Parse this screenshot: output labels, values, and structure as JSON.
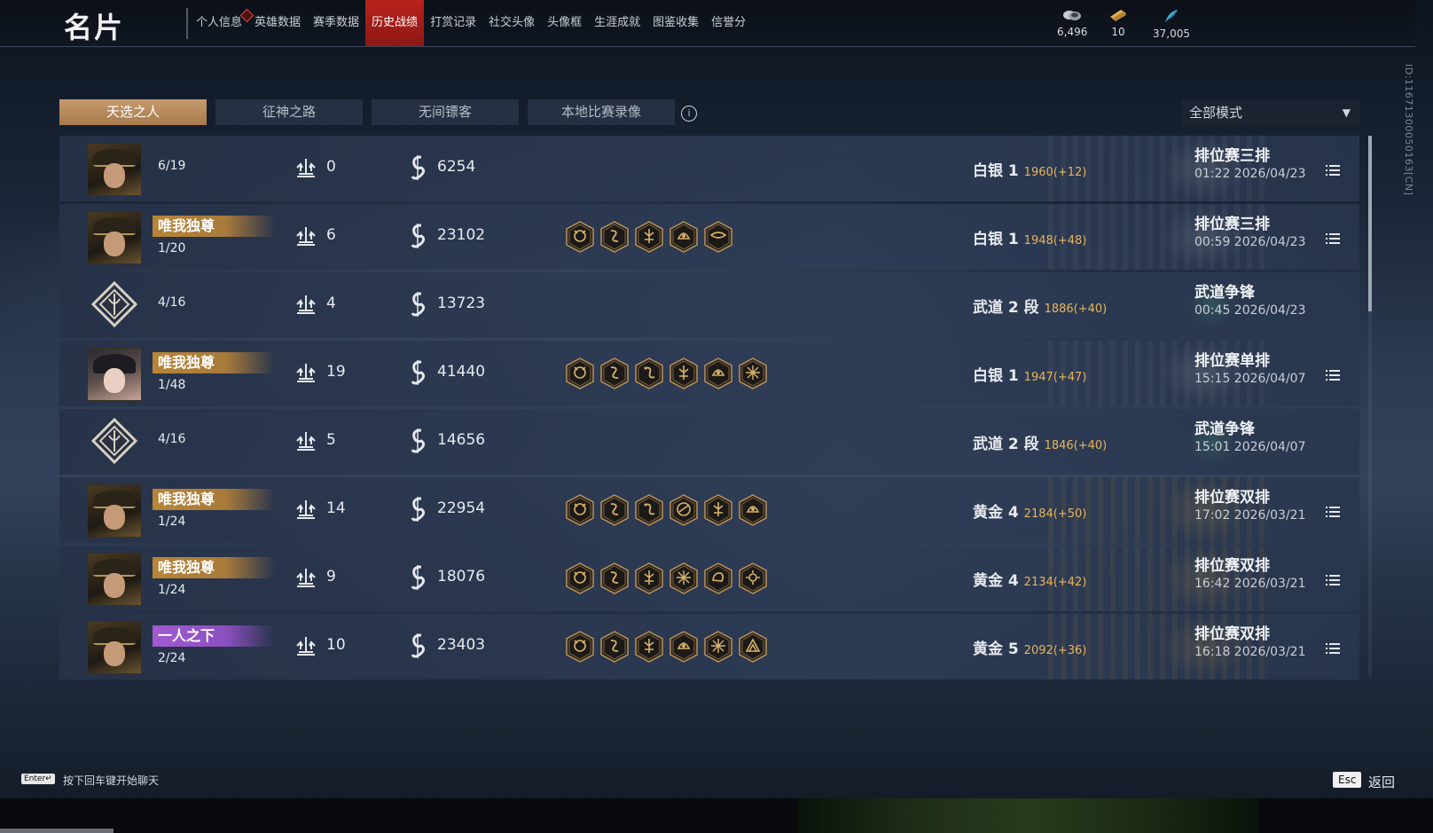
{
  "header": {
    "title": "名片",
    "tabs": [
      {
        "label": "个人信息",
        "active": false,
        "alert": true
      },
      {
        "label": "英雄数据",
        "active": false
      },
      {
        "label": "赛季数据",
        "active": false
      },
      {
        "label": "历史战绩",
        "active": true
      },
      {
        "label": "打赏记录",
        "active": false
      },
      {
        "label": "社交头像",
        "active": false
      },
      {
        "label": "头像框",
        "active": false
      },
      {
        "label": "生涯成就",
        "active": false
      },
      {
        "label": "图鉴收集",
        "active": false
      },
      {
        "label": "信誉分",
        "active": false
      }
    ],
    "currencies": [
      {
        "icon": "coin-stack-icon",
        "value": "6,496"
      },
      {
        "icon": "ticket-icon",
        "value": "10"
      },
      {
        "icon": "feather-icon",
        "value": "37,005"
      }
    ],
    "player_id": "ID:11671300050163[CN]"
  },
  "subtabs": [
    {
      "label": "天选之人",
      "active": true
    },
    {
      "label": "征神之路",
      "active": false
    },
    {
      "label": "无间镖客",
      "active": false
    },
    {
      "label": "本地比赛录像",
      "active": false
    }
  ],
  "mode_filter": {
    "selected": "全部模式"
  },
  "matches": [
    {
      "avatar": "hat-hero",
      "badge": "",
      "badge_color": "",
      "placement": "6/19",
      "kills": "0",
      "damage": "6254",
      "medals": [],
      "rank": "白银 1",
      "score": "1960(+12)",
      "mode": "排位赛三排",
      "time": "01:22  2026/04/23",
      "has_detail": true,
      "deco": "silver"
    },
    {
      "avatar": "hat-hero",
      "badge": "唯我独尊",
      "badge_color": "gold",
      "placement": "1/20",
      "kills": "6",
      "damage": "23102",
      "medals": [
        "demon-medal-icon",
        "serpent-medal-icon",
        "rune-medal-icon",
        "helm-medal-icon",
        "eagle-medal-icon"
      ],
      "rank": "白银 1",
      "score": "1948(+48)",
      "mode": "排位赛三排",
      "time": "00:59  2026/04/23",
      "has_detail": true,
      "deco": "silver"
    },
    {
      "avatar": "emblem",
      "badge": "",
      "badge_color": "",
      "placement": "4/16",
      "kills": "4",
      "damage": "13723",
      "medals": [],
      "rank": "武道 2 段",
      "score": "1886(+40)",
      "mode": "武道争锋",
      "time": "00:45  2026/04/23",
      "has_detail": false,
      "deco": "green"
    },
    {
      "avatar": "girl-hero",
      "badge": "唯我独尊",
      "badge_color": "gold",
      "placement": "1/48",
      "kills": "19",
      "damage": "41440",
      "medals": [
        "demon-medal-icon",
        "serpent-medal-icon",
        "dragon-medal-icon",
        "rune-medal-icon",
        "helm-medal-icon",
        "star-medal-icon"
      ],
      "rank": "白银 1",
      "score": "1947(+47)",
      "mode": "排位赛单排",
      "time": "15:15  2026/04/07",
      "has_detail": true,
      "deco": "silver"
    },
    {
      "avatar": "emblem",
      "badge": "",
      "badge_color": "",
      "placement": "4/16",
      "kills": "5",
      "damage": "14656",
      "medals": [],
      "rank": "武道 2 段",
      "score": "1846(+40)",
      "mode": "武道争锋",
      "time": "15:01  2026/04/07",
      "has_detail": false,
      "deco": "green"
    },
    {
      "avatar": "hat-hero",
      "badge": "唯我独尊",
      "badge_color": "gold",
      "placement": "1/24",
      "kills": "14",
      "damage": "22954",
      "medals": [
        "demon-medal-icon",
        "serpent-medal-icon",
        "dragon-medal-icon",
        "coil-medal-icon",
        "rune-medal-icon",
        "helm-medal-icon"
      ],
      "rank": "黄金 4",
      "score": "2184(+50)",
      "mode": "排位赛双排",
      "time": "17:02  2026/03/21",
      "has_detail": true,
      "deco": "gold"
    },
    {
      "avatar": "hat-hero",
      "badge": "唯我独尊",
      "badge_color": "gold",
      "placement": "1/24",
      "kills": "9",
      "damage": "18076",
      "medals": [
        "demon-medal-icon",
        "serpent-medal-icon",
        "rune-medal-icon",
        "star-medal-icon",
        "fist-medal-icon",
        "sun-medal-icon"
      ],
      "rank": "黄金 4",
      "score": "2134(+42)",
      "mode": "排位赛双排",
      "time": "16:42  2026/03/21",
      "has_detail": true,
      "deco": "gold"
    },
    {
      "avatar": "hat-hero",
      "badge": "一人之下",
      "badge_color": "purple",
      "placement": "2/24",
      "kills": "10",
      "damage": "23403",
      "medals": [
        "demon-medal-icon",
        "serpent-medal-icon",
        "rune-medal-icon",
        "helm-medal-icon",
        "star-medal-icon",
        "peak-medal-icon"
      ],
      "rank": "黄金 5",
      "score": "2092(+36)",
      "mode": "排位赛双排",
      "time": "16:18  2026/03/21",
      "has_detail": true,
      "deco": "gold"
    }
  ],
  "footer": {
    "enter_key": "Enter↵",
    "chat_hint": "按下回车键开始聊天",
    "esc_key": "Esc",
    "back_label": "返回"
  },
  "colors": {
    "accent_gold": "#c49a6c",
    "tab_active_red": "#b8231d",
    "score_orange": "#e8b45a",
    "badge_purple": "#a15bd0"
  }
}
